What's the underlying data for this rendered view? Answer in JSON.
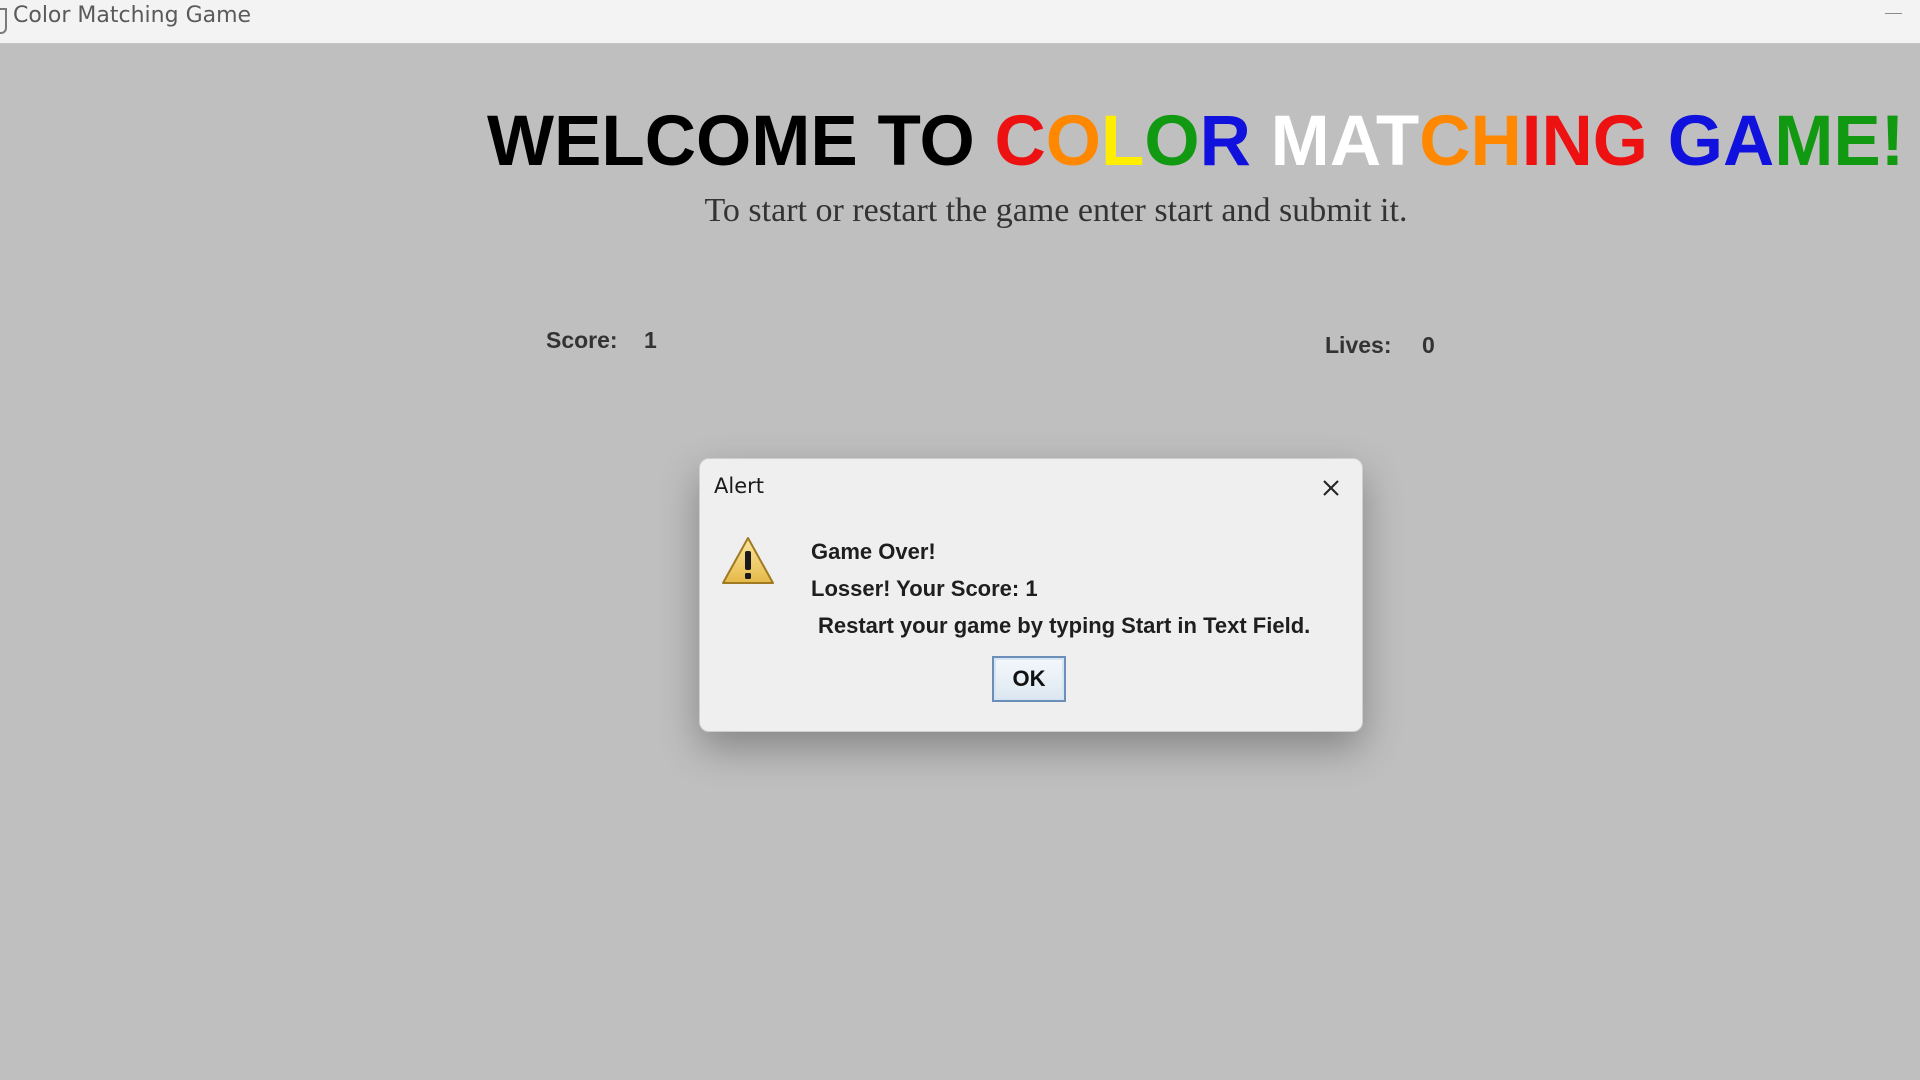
{
  "window": {
    "title": "Color Matching Game"
  },
  "heading": {
    "segments": [
      {
        "text": "WELCOME TO ",
        "color": "#000000"
      },
      {
        "text": "C",
        "color": "#ee1111"
      },
      {
        "text": "O",
        "color": "#ff8800"
      },
      {
        "text": "L",
        "color": "#ffee00"
      },
      {
        "text": "O",
        "color": "#119911"
      },
      {
        "text": "R",
        "color": "#1111dd"
      },
      {
        "text": " ",
        "color": "#000000"
      },
      {
        "text": "M",
        "color": "#ffffff"
      },
      {
        "text": "A",
        "color": "#ffffff"
      },
      {
        "text": "T",
        "color": "#ffffff"
      },
      {
        "text": "C",
        "color": "#ff8800"
      },
      {
        "text": "H",
        "color": "#ff8800"
      },
      {
        "text": "I",
        "color": "#ee1111"
      },
      {
        "text": "N",
        "color": "#ee1111"
      },
      {
        "text": "G",
        "color": "#ee1111"
      },
      {
        "text": " ",
        "color": "#000000"
      },
      {
        "text": "G",
        "color": "#1111dd"
      },
      {
        "text": "A",
        "color": "#1111dd"
      },
      {
        "text": "M",
        "color": "#119911"
      },
      {
        "text": "E",
        "color": "#119911"
      },
      {
        "text": "!",
        "color": "#119911"
      }
    ]
  },
  "instructions": "To start or restart the game enter start and submit it.",
  "stats": {
    "score_label": "Score:",
    "score_value": "1",
    "lives_label": "Lives:",
    "lives_value": "0"
  },
  "game": {
    "color_word_color": "#22d422"
  },
  "dialog": {
    "title": "Alert",
    "icon": "warning-icon",
    "line1": "Game Over!",
    "line2": "Losser!  Your Score: 1",
    "line3": "Restart your game by typing Start in Text Field.",
    "ok_label": "OK"
  }
}
